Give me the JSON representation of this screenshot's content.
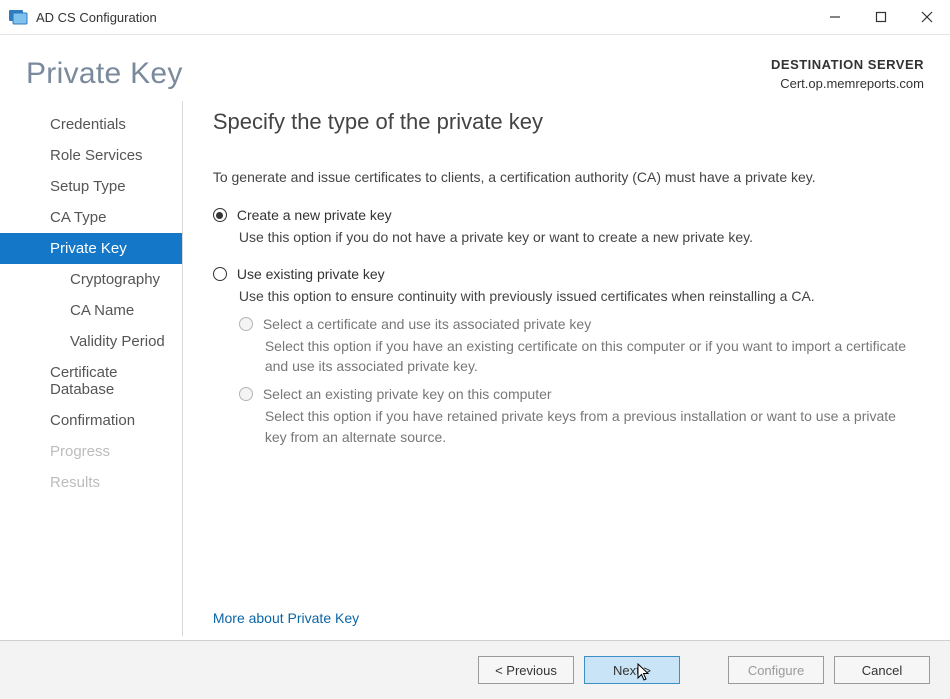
{
  "titlebar": {
    "app_title": "AD CS Configuration"
  },
  "header": {
    "page_title": "Private Key",
    "destination_label": "DESTINATION SERVER",
    "destination_server": "Cert.op.memreports.com"
  },
  "sidebar": {
    "items": [
      {
        "label": "Credentials",
        "child": false,
        "selected": false,
        "disabled": false
      },
      {
        "label": "Role Services",
        "child": false,
        "selected": false,
        "disabled": false
      },
      {
        "label": "Setup Type",
        "child": false,
        "selected": false,
        "disabled": false
      },
      {
        "label": "CA Type",
        "child": false,
        "selected": false,
        "disabled": false
      },
      {
        "label": "Private Key",
        "child": false,
        "selected": true,
        "disabled": false
      },
      {
        "label": "Cryptography",
        "child": true,
        "selected": false,
        "disabled": false
      },
      {
        "label": "CA Name",
        "child": true,
        "selected": false,
        "disabled": false
      },
      {
        "label": "Validity Period",
        "child": true,
        "selected": false,
        "disabled": false
      },
      {
        "label": "Certificate Database",
        "child": false,
        "selected": false,
        "disabled": false
      },
      {
        "label": "Confirmation",
        "child": false,
        "selected": false,
        "disabled": false
      },
      {
        "label": "Progress",
        "child": false,
        "selected": false,
        "disabled": true
      },
      {
        "label": "Results",
        "child": false,
        "selected": false,
        "disabled": true
      }
    ]
  },
  "content": {
    "heading": "Specify the type of the private key",
    "intro": "To generate and issue certificates to clients, a certification authority (CA) must have a private key.",
    "option_new": {
      "label": "Create a new private key",
      "desc": "Use this option if you do not have a private key or want to create a new private key."
    },
    "option_existing": {
      "label": "Use existing private key",
      "desc": "Use this option to ensure continuity with previously issued certificates when reinstalling a CA.",
      "sub_cert": {
        "label": "Select a certificate and use its associated private key",
        "desc": "Select this option if you have an existing certificate on this computer or if you want to import a certificate and use its associated private key."
      },
      "sub_key": {
        "label": "Select an existing private key on this computer",
        "desc": "Select this option if you have retained private keys from a previous installation or want to use a private key from an alternate source."
      }
    },
    "more_link": "More about Private Key"
  },
  "footer": {
    "previous": "< Previous",
    "next": "Next >",
    "configure": "Configure",
    "cancel": "Cancel"
  }
}
